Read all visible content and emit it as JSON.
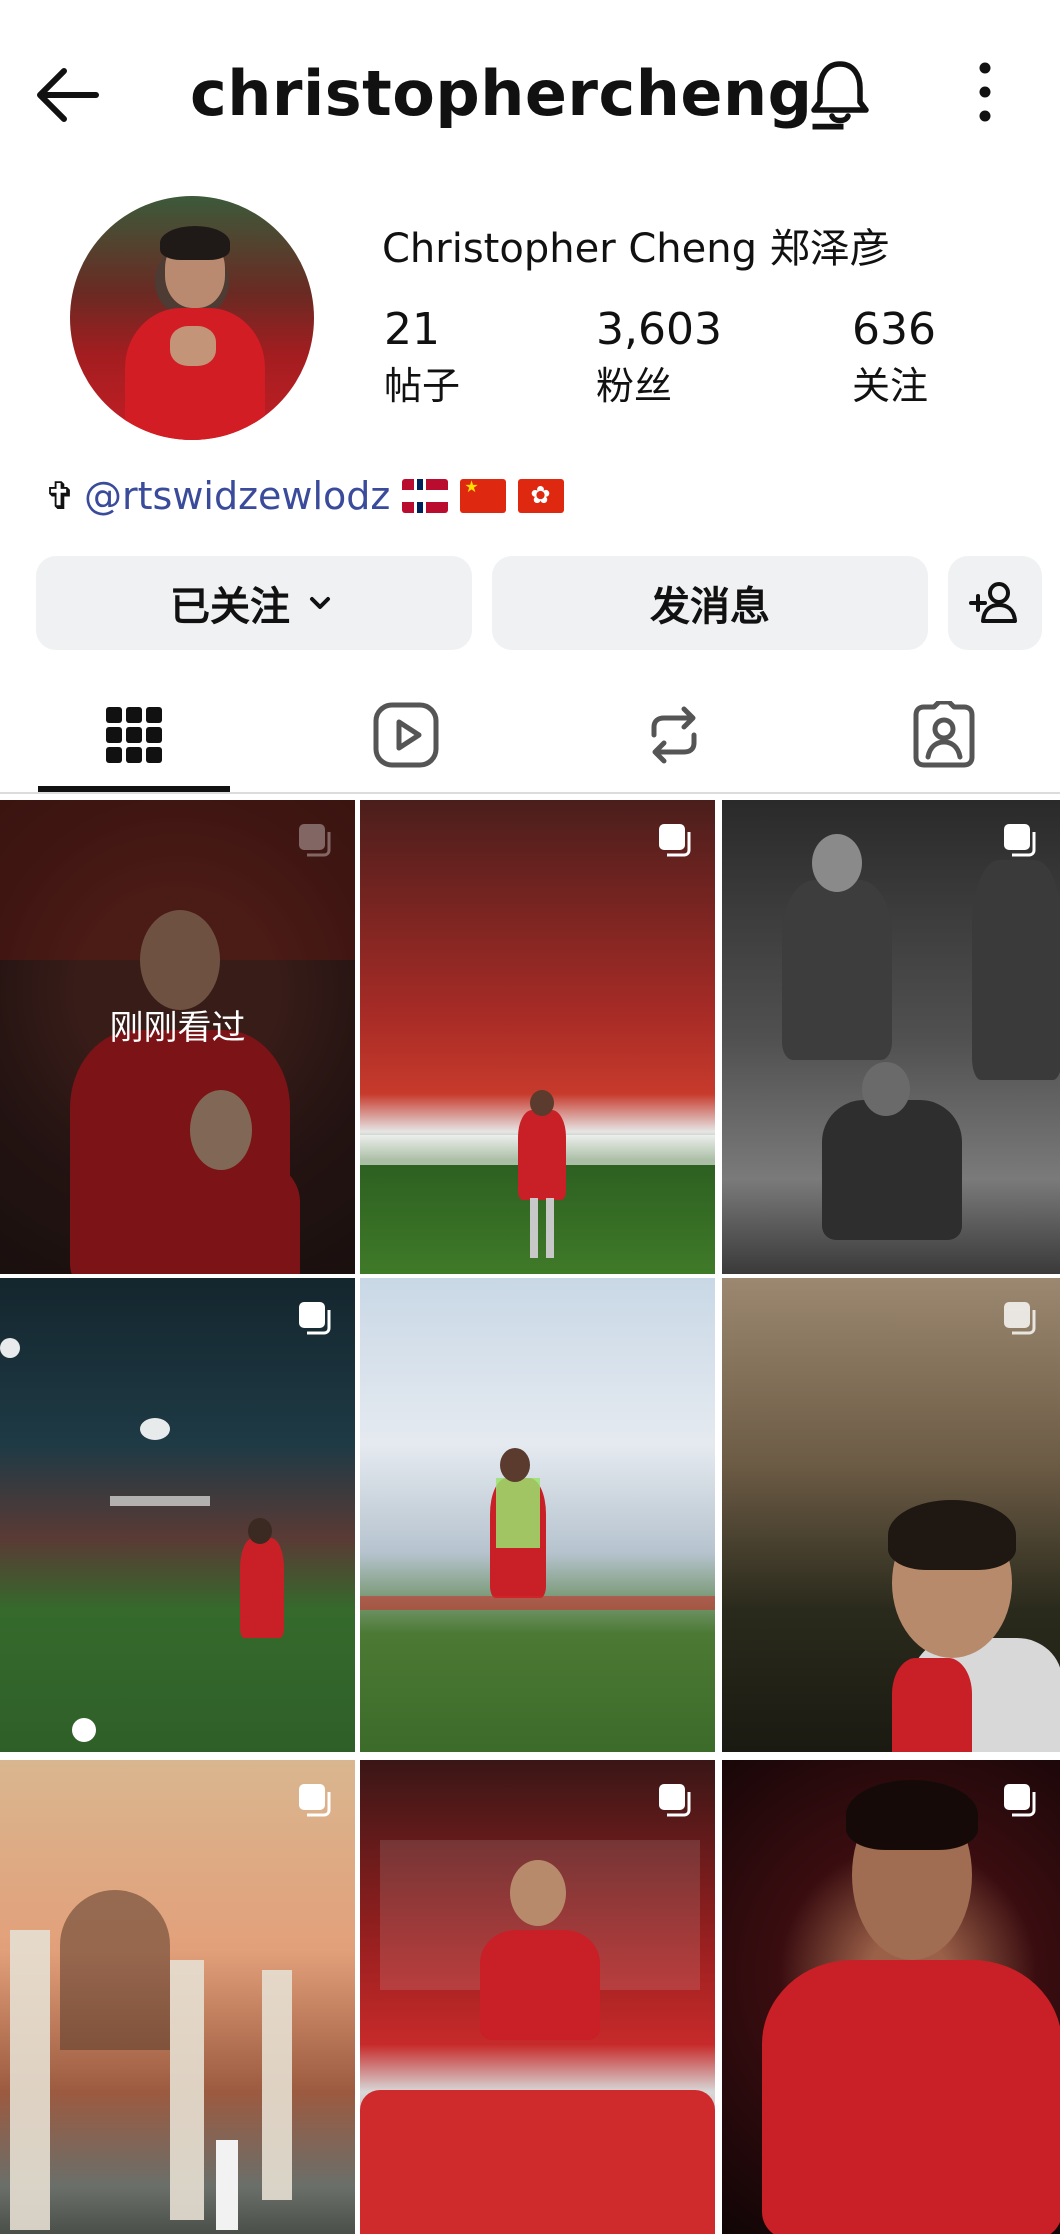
{
  "header": {
    "username": "christophercheng_",
    "back_icon": "arrow-left-icon",
    "bell_icon": "bell-icon",
    "more_icon": "more-vertical-icon"
  },
  "profile": {
    "full_name": "Christopher Cheng 郑泽彦",
    "stats": [
      {
        "value": "21",
        "label": "帖子"
      },
      {
        "value": "3,603",
        "label": "粉丝"
      },
      {
        "value": "636",
        "label": "关注"
      }
    ],
    "bio_cross": "✞",
    "bio_link": "@rtswidzewlodz",
    "flags": [
      "norway-flag",
      "china-flag",
      "hong-kong-flag"
    ]
  },
  "actions": {
    "following_label": "已关注",
    "message_label": "发消息"
  },
  "tabs": [
    "posts-grid-icon",
    "reels-icon",
    "reposts-icon",
    "tagged-icon"
  ],
  "grid": {
    "recently_viewed_label": "刚刚看过"
  },
  "colors": {
    "link": "#3a4b9b",
    "button_bg": "#eff1f3",
    "accent_red": "#c82026"
  }
}
